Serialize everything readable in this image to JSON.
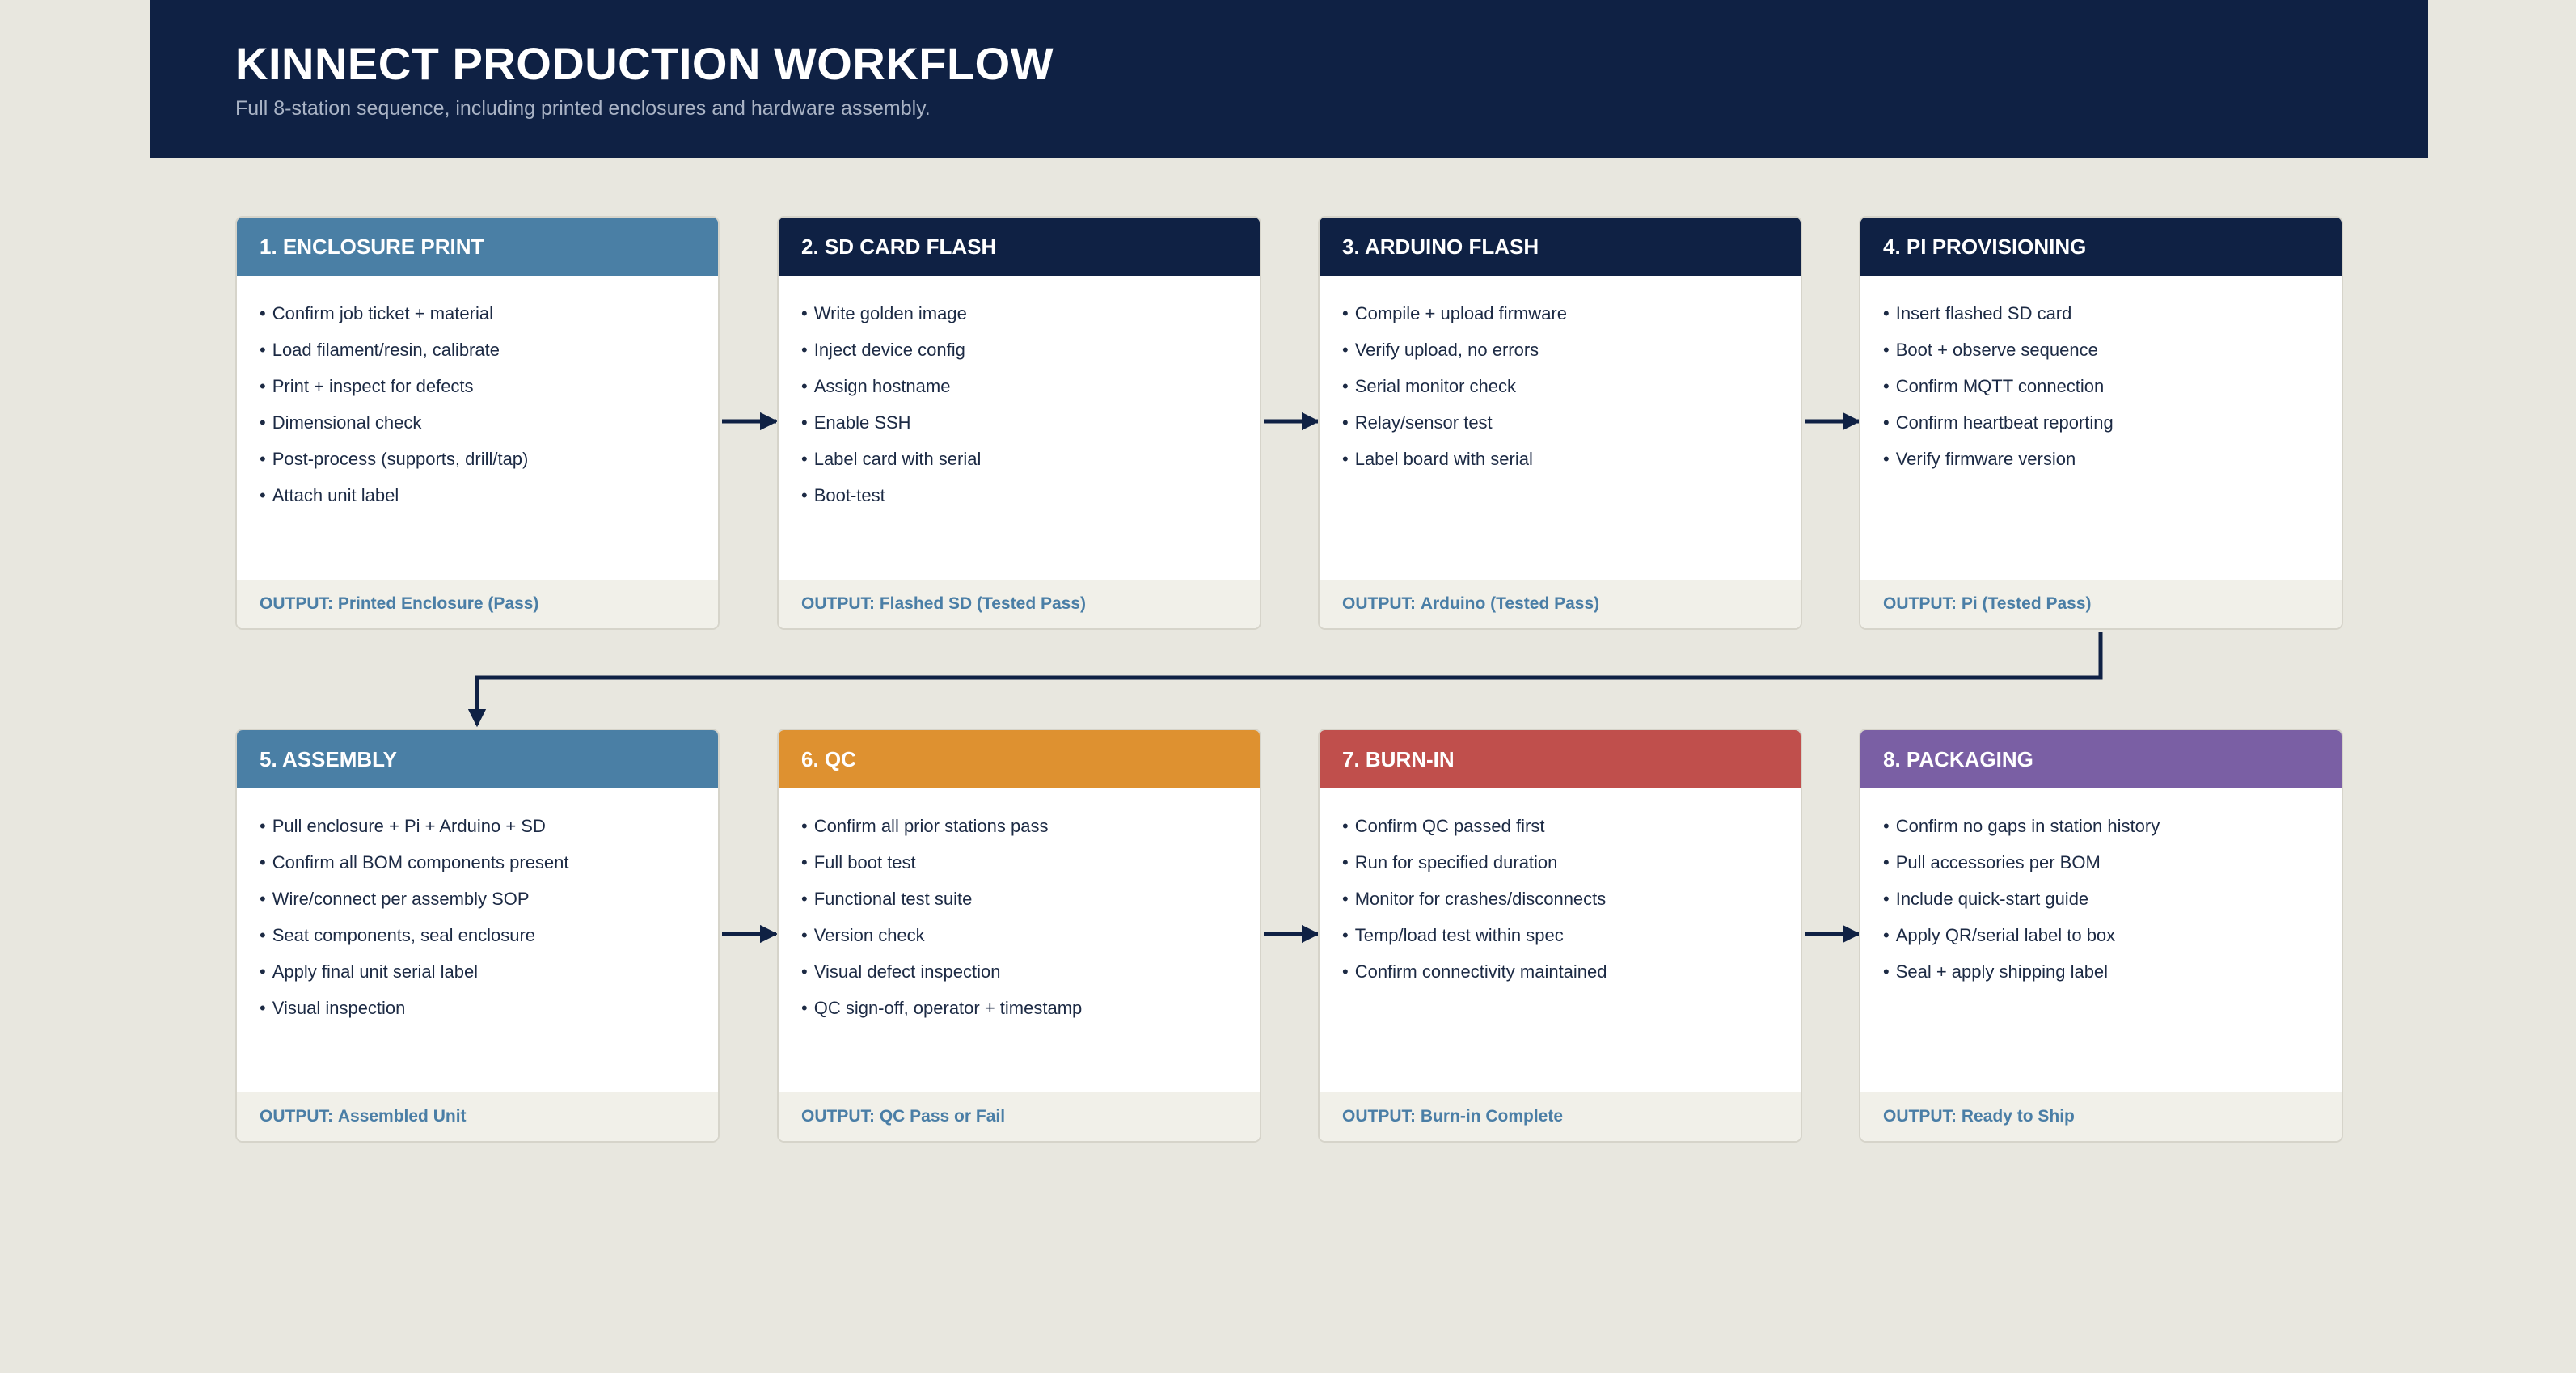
{
  "header": {
    "title": "KINNECT PRODUCTION WORKFLOW",
    "subtitle": "Full 8-station sequence, including printed enclosures and hardware assembly."
  },
  "colors": {
    "navy": "#0f2144",
    "steel_blue": "#4a7fa5",
    "orange": "#de9130",
    "red": "#c04f4c",
    "purple": "#7a5fa4",
    "output_text": "#4a7ea6",
    "background": "#e8e7df"
  },
  "stations": [
    {
      "title": "1. ENCLOSURE PRINT",
      "header_color": "#4a7fa5",
      "items": [
        "Confirm job ticket + material",
        "Load filament/resin, calibrate",
        "Print + inspect for defects",
        "Dimensional check",
        "Post-process (supports, drill/tap)",
        "Attach unit label"
      ],
      "output_label": "OUTPUT:",
      "output_value": "Printed Enclosure (Pass)"
    },
    {
      "title": "2. SD CARD FLASH",
      "header_color": "#0f2144",
      "items": [
        "Write golden image",
        "Inject device config",
        "Assign hostname",
        "Enable SSH",
        "Label card with serial",
        "Boot-test"
      ],
      "output_label": "OUTPUT:",
      "output_value": "Flashed SD (Tested Pass)"
    },
    {
      "title": "3. ARDUINO FLASH",
      "header_color": "#0f2144",
      "items": [
        "Compile + upload firmware",
        "Verify upload, no errors",
        "Serial monitor check",
        "Relay/sensor test",
        "Label board with serial"
      ],
      "output_label": "OUTPUT:",
      "output_value": "Arduino (Tested Pass)"
    },
    {
      "title": "4. PI PROVISIONING",
      "header_color": "#0f2144",
      "items": [
        "Insert flashed SD card",
        "Boot + observe sequence",
        "Confirm MQTT connection",
        "Confirm heartbeat reporting",
        "Verify firmware version"
      ],
      "output_label": "OUTPUT:",
      "output_value": "Pi (Tested Pass)"
    },
    {
      "title": "5. ASSEMBLY",
      "header_color": "#4a7fa5",
      "items": [
        "Pull enclosure + Pi + Arduino + SD",
        "Confirm all BOM components present",
        "Wire/connect per assembly SOP",
        "Seat components, seal enclosure",
        "Apply final unit serial label",
        "Visual inspection"
      ],
      "output_label": "OUTPUT:",
      "output_value": "Assembled Unit"
    },
    {
      "title": "6. QC",
      "header_color": "#de9130",
      "items": [
        "Confirm all prior stations pass",
        "Full boot test",
        "Functional test suite",
        "Version check",
        "Visual defect inspection",
        "QC sign-off, operator + timestamp"
      ],
      "output_label": "OUTPUT:",
      "output_value": "QC Pass or Fail"
    },
    {
      "title": "7. BURN-IN",
      "header_color": "#c04f4c",
      "items": [
        "Confirm QC passed first",
        "Run for specified duration",
        "Monitor for crashes/disconnects",
        "Temp/load test within spec",
        "Confirm connectivity maintained"
      ],
      "output_label": "OUTPUT:",
      "output_value": "Burn-in Complete"
    },
    {
      "title": "8. PACKAGING",
      "header_color": "#7a5fa4",
      "items": [
        "Confirm no gaps in station history",
        "Pull accessories per BOM",
        "Include quick-start guide",
        "Apply QR/serial label to box",
        "Seal + apply shipping label"
      ],
      "output_label": "OUTPUT:",
      "output_value": "Ready to Ship"
    }
  ]
}
